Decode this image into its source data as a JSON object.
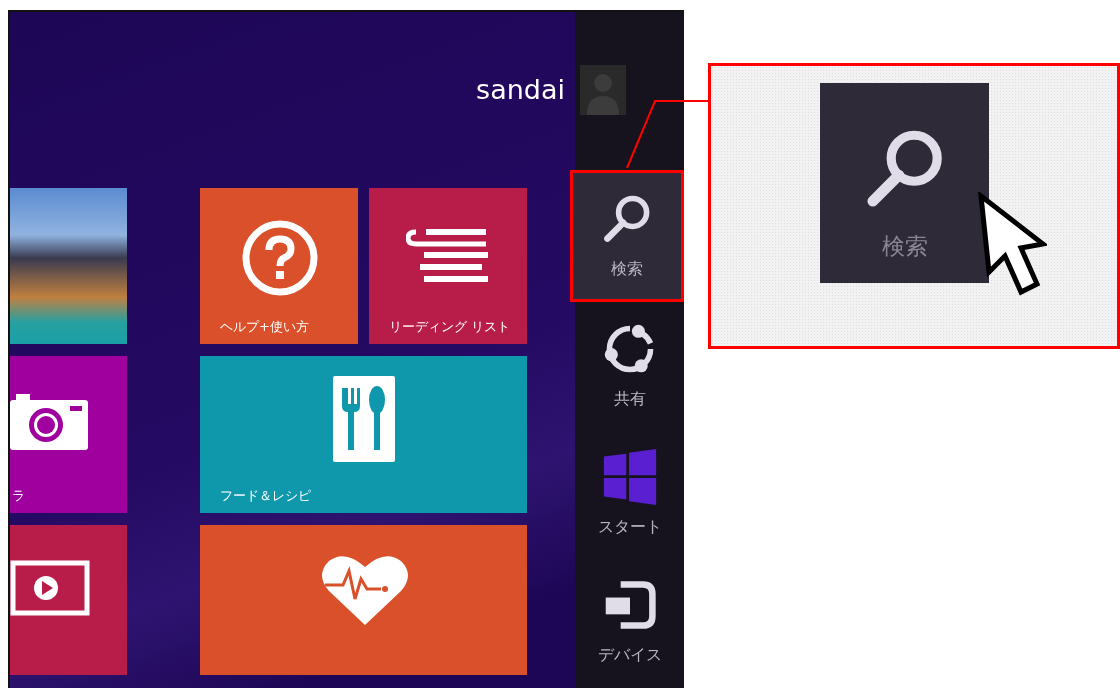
{
  "user": {
    "name": "sandai"
  },
  "tiles": [
    {
      "kind": "photo"
    },
    {
      "kind": "help",
      "label": "ヘルプ+使い方"
    },
    {
      "kind": "reading",
      "label": "リーディング リスト"
    },
    {
      "kind": "camera",
      "label": "ラ"
    },
    {
      "kind": "food",
      "label": "フード＆レシピ"
    },
    {
      "kind": "video"
    },
    {
      "kind": "health"
    }
  ],
  "charms": [
    {
      "kind": "search",
      "label": "検索",
      "selected": true
    },
    {
      "kind": "share",
      "label": "共有",
      "selected": false
    },
    {
      "kind": "start",
      "label": "スタート",
      "selected": false
    },
    {
      "kind": "devices",
      "label": "デバイス",
      "selected": false
    }
  ],
  "callout": {
    "kind": "search",
    "label": "検索"
  }
}
